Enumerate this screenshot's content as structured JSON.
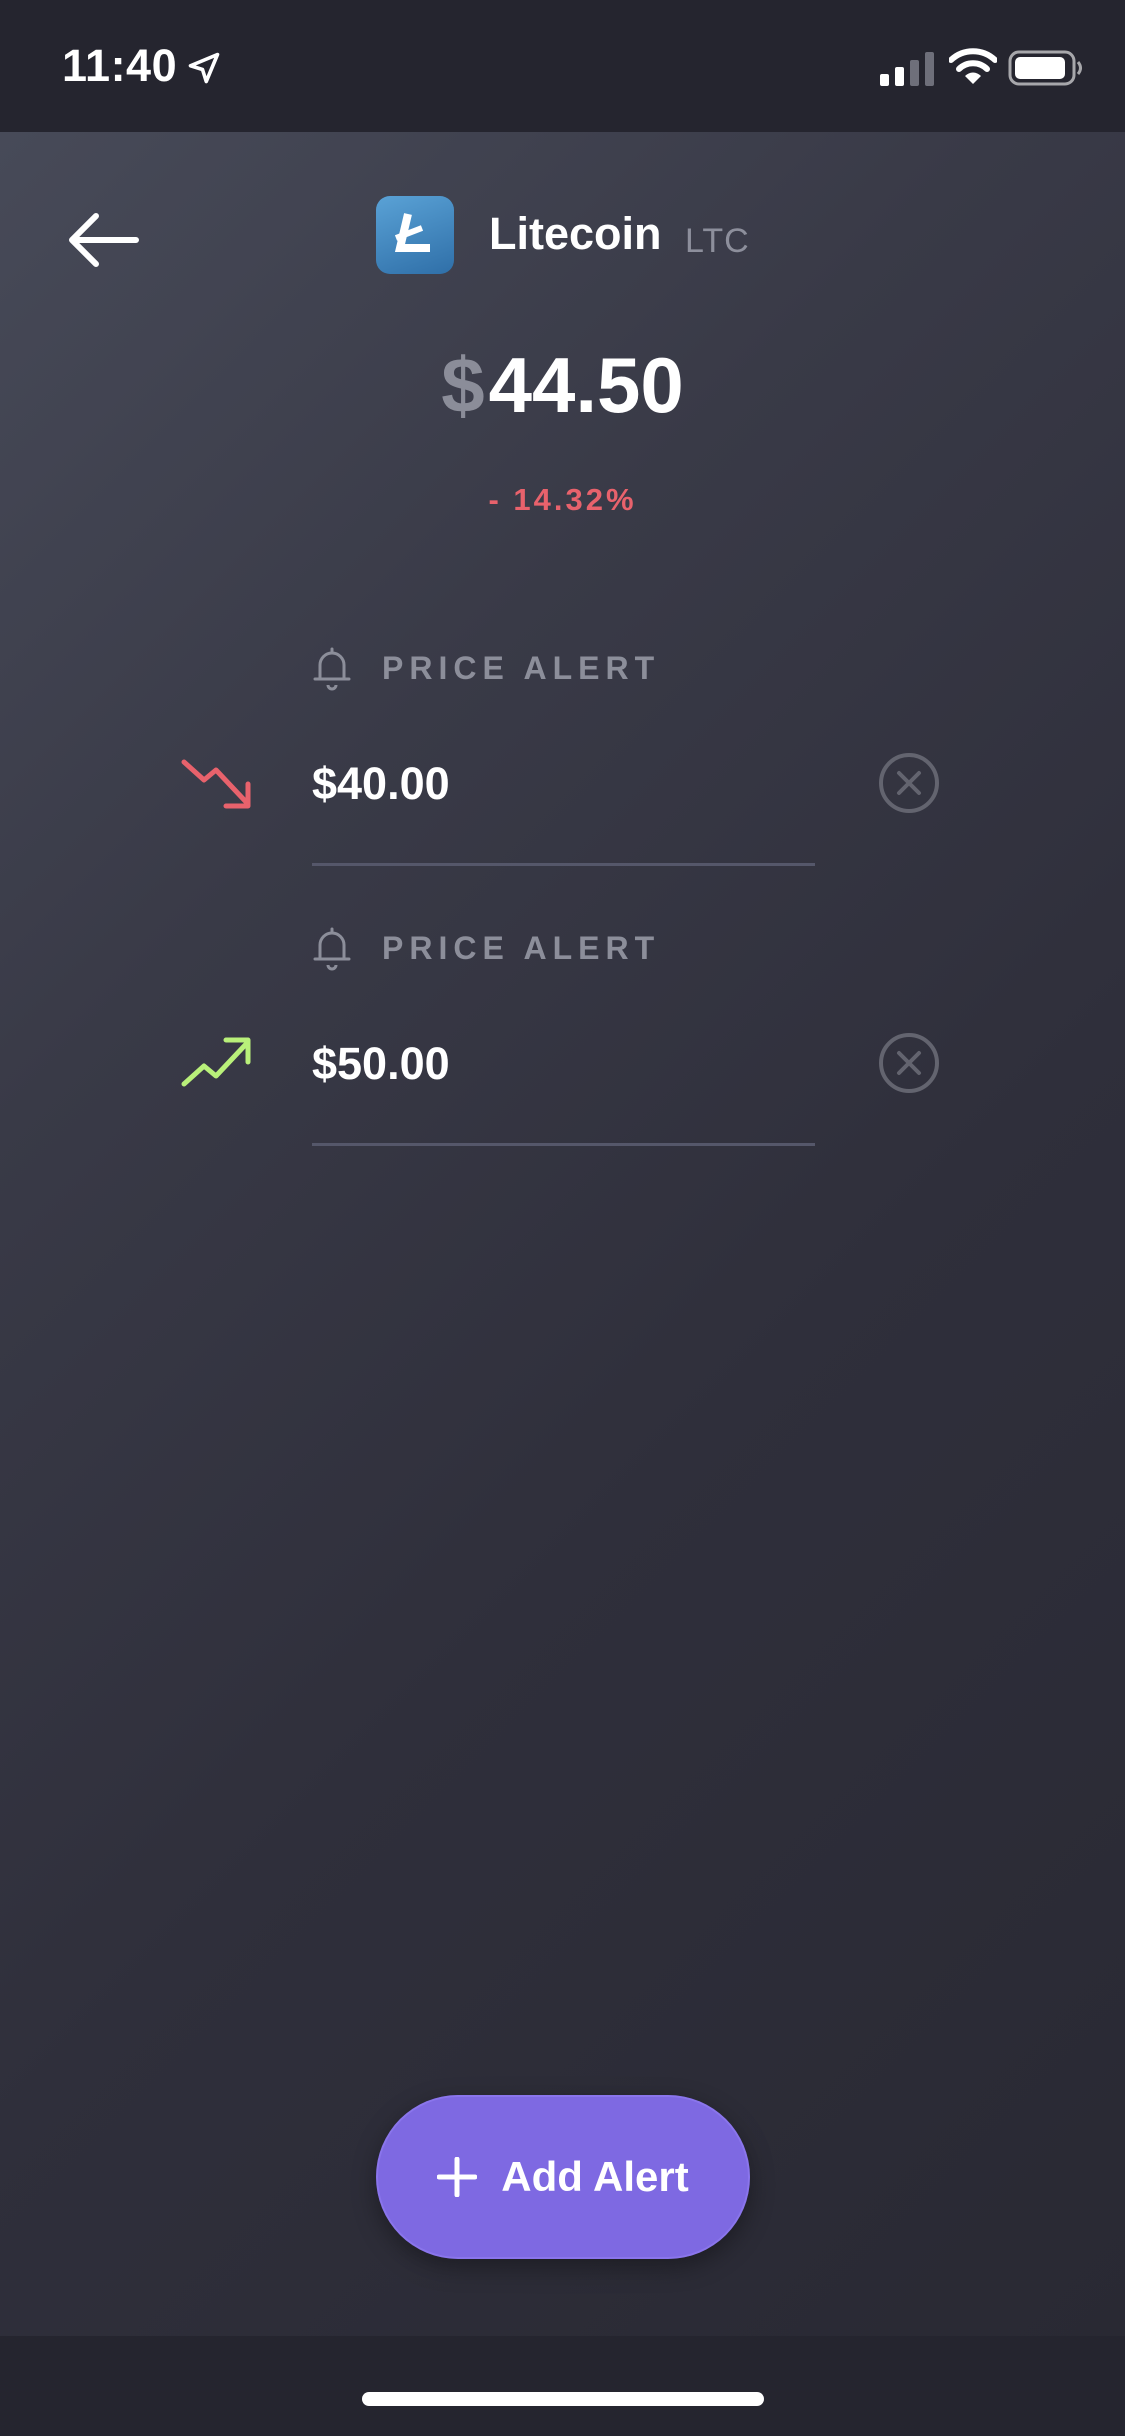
{
  "status_bar": {
    "time": "11:40"
  },
  "header": {
    "coin_name": "Litecoin",
    "coin_ticker": "LTC",
    "price_currency": "$",
    "price_value": "44.50",
    "price_change": "- 14.32%"
  },
  "alerts": [
    {
      "label": "PRICE ALERT",
      "price": "$40.00",
      "direction": "down",
      "icon": "trending-down-icon",
      "color": "#e8626c"
    },
    {
      "label": "PRICE ALERT",
      "price": "$50.00",
      "direction": "up",
      "icon": "trending-up-icon",
      "color": "#b9f07a"
    }
  ],
  "add_alert": {
    "label": "Add Alert",
    "color": "#7e69e2"
  }
}
